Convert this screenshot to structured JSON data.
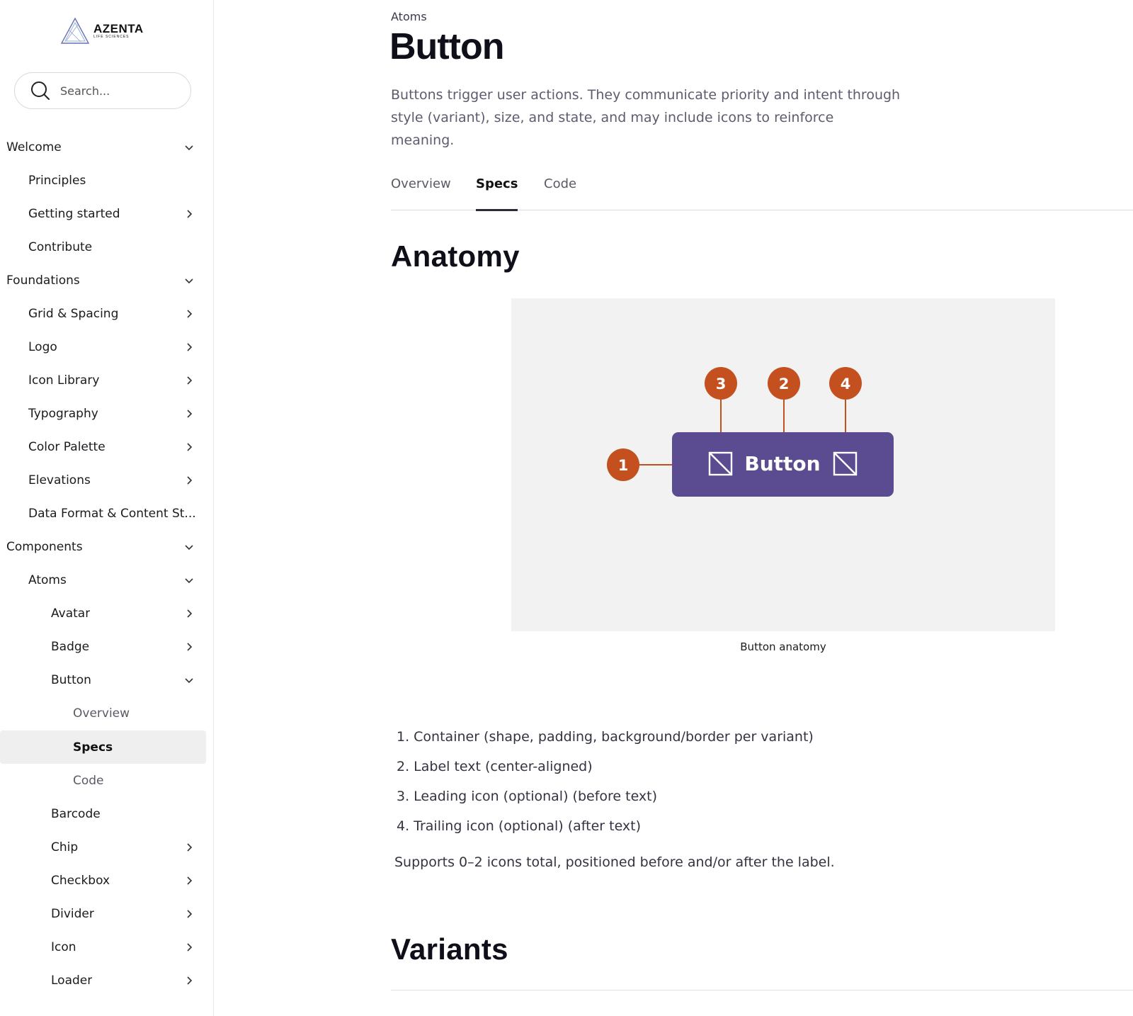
{
  "logo": {
    "name": "AZENTA",
    "sub": "LIFE SCIENCES"
  },
  "search": {
    "placeholder": "Search..."
  },
  "sidebar": {
    "items": [
      {
        "label": "Welcome",
        "chev": "down"
      },
      {
        "label": "Principles",
        "chev": ""
      },
      {
        "label": "Getting started",
        "chev": "right"
      },
      {
        "label": "Contribute",
        "chev": ""
      },
      {
        "label": "Foundations",
        "chev": "down"
      },
      {
        "label": "Grid & Spacing",
        "chev": "right"
      },
      {
        "label": "Logo",
        "chev": "right"
      },
      {
        "label": "Icon Library",
        "chev": "right"
      },
      {
        "label": "Typography",
        "chev": "right"
      },
      {
        "label": "Color Palette",
        "chev": "right"
      },
      {
        "label": "Elevations",
        "chev": "right"
      },
      {
        "label": "Data Format & Content St...",
        "chev": ""
      },
      {
        "label": "Components",
        "chev": "down"
      },
      {
        "label": "Atoms",
        "chev": "down"
      },
      {
        "label": "Avatar",
        "chev": "right"
      },
      {
        "label": "Badge",
        "chev": "right"
      },
      {
        "label": "Button",
        "chev": "down"
      },
      {
        "label": "Overview",
        "chev": ""
      },
      {
        "label": "Specs",
        "chev": "",
        "active": true
      },
      {
        "label": "Code",
        "chev": ""
      },
      {
        "label": "Barcode",
        "chev": ""
      },
      {
        "label": "Chip",
        "chev": "right"
      },
      {
        "label": "Checkbox",
        "chev": "right"
      },
      {
        "label": "Divider",
        "chev": "right"
      },
      {
        "label": "Icon",
        "chev": "right"
      },
      {
        "label": "Loader",
        "chev": "right"
      }
    ]
  },
  "main": {
    "breadcrumb": "Atoms",
    "title": "Button",
    "description": "Buttons trigger user actions. They communicate priority and intent through style (variant), size, and state, and may include icons to reinforce meaning.",
    "tabs": [
      {
        "label": "Overview"
      },
      {
        "label": "Specs",
        "active": true
      },
      {
        "label": "Code"
      }
    ],
    "anatomy": {
      "heading": "Anatomy",
      "button_label": "Button",
      "markers": [
        "1",
        "2",
        "3",
        "4"
      ],
      "caption": "Button anatomy",
      "button_color": "#5b4b91",
      "marker_color": "#c4501f",
      "list": [
        "1. Container (shape, padding, background/border per variant)",
        "2. Label text (center-aligned)",
        "3. Leading icon (optional) (before text)",
        "4. Trailing icon (optional) (after text)"
      ],
      "note": "Supports 0–2 icons total, positioned before and/or after the label."
    },
    "variants_heading": "Variants"
  }
}
